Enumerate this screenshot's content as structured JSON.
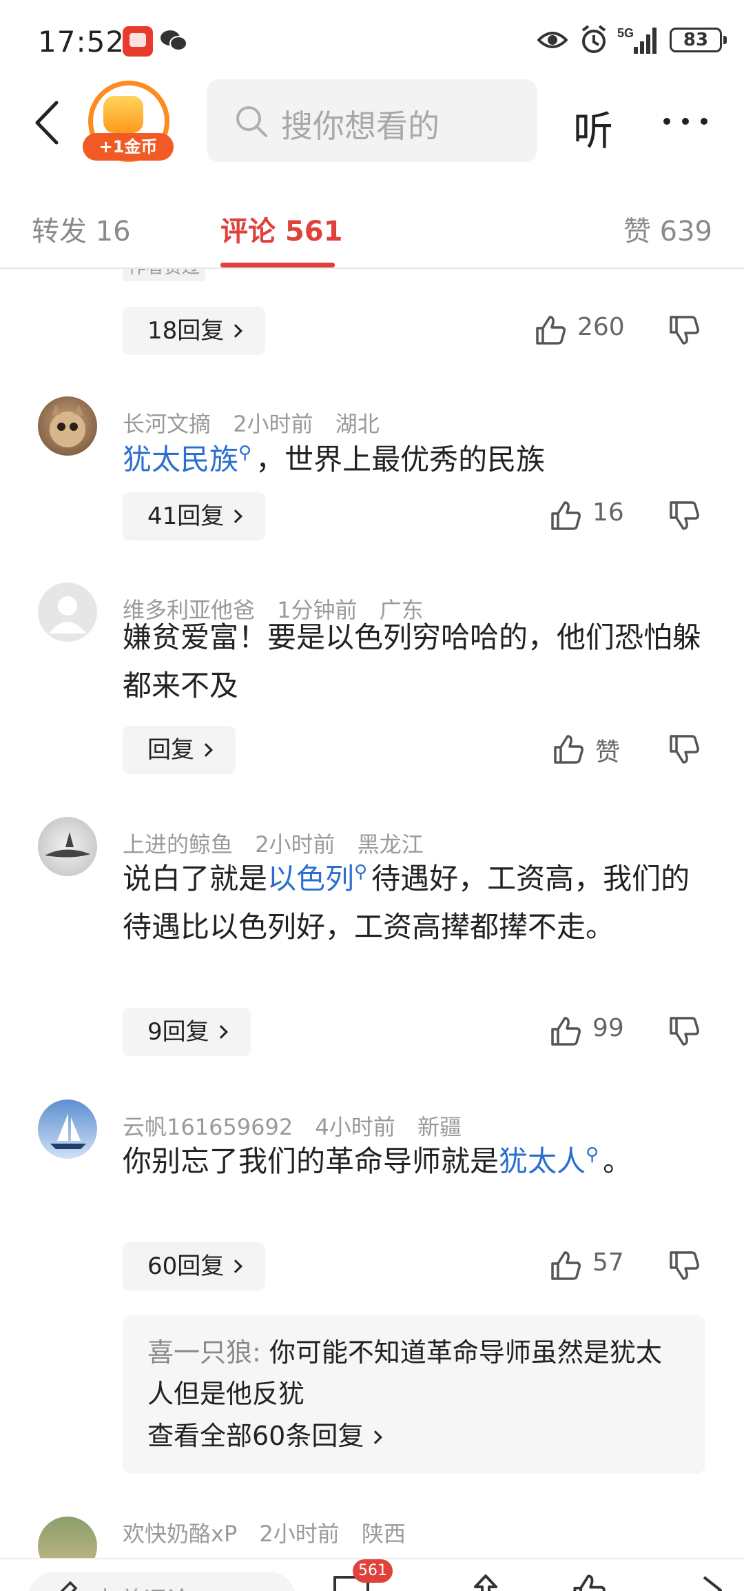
{
  "status_bar": {
    "time": "17:52",
    "network": "5G",
    "battery": "83",
    "icons": [
      "app-notification-icon",
      "wechat-icon",
      "eye-icon",
      "alarm-icon",
      "signal-icon",
      "battery-icon"
    ]
  },
  "nav": {
    "coin_label": "+1金币",
    "search_placeholder": "搜你想看的",
    "listen_label": "听"
  },
  "tabs": {
    "repost": "转发 16",
    "comments": "评论 561",
    "likes": "赞 639"
  },
  "comments": {
    "top_partial": {
      "author_liked_badge": "作者赞过",
      "replies_label": "18回复",
      "likes": "260"
    },
    "items": [
      {
        "author": "长河文摘",
        "time": "2小时前",
        "location": "湖北",
        "link_text": "犹太民族",
        "text_after": "，世界上最优秀的民族",
        "replies_label": "41回复",
        "likes": "16"
      },
      {
        "author": "维多利亚他爸",
        "time": "1分钟前",
        "location": "广东",
        "text": "嫌贫爱富！要是以色列穷哈哈的，他们恐怕躲都来不及",
        "replies_label": "回复",
        "likes": "赞"
      },
      {
        "author": "上进的鲸鱼",
        "time": "2小时前",
        "location": "黑龙江",
        "text_before": "说白了就是",
        "link_text": "以色列",
        "text_after": "待遇好，工资高，我们的待遇比以色列好，工资高撵都撵不走。",
        "replies_label": "9回复",
        "likes": "99"
      },
      {
        "author": "云帆161659692",
        "time": "4小时前",
        "location": "新疆",
        "text_before": "你别忘了我们的革命导师就是",
        "link_text": "犹太人",
        "text_after": "。",
        "replies_label": "60回复",
        "likes": "57",
        "sub_reply": {
          "author": "喜一只狼:",
          "text": "你可能不知道革命导师虽然是犹太人但是他反犹",
          "view_all": "查看全部60条回复"
        }
      },
      {
        "author": "欢快奶酪xP",
        "time": "2小时前",
        "location": "陕西"
      }
    ]
  },
  "bottom_bar": {
    "input_placeholder": "友善评论",
    "comment_count": "561"
  },
  "colors": {
    "accent": "#e0413a",
    "link": "#2a6fcf",
    "coin": "#f15a24"
  }
}
